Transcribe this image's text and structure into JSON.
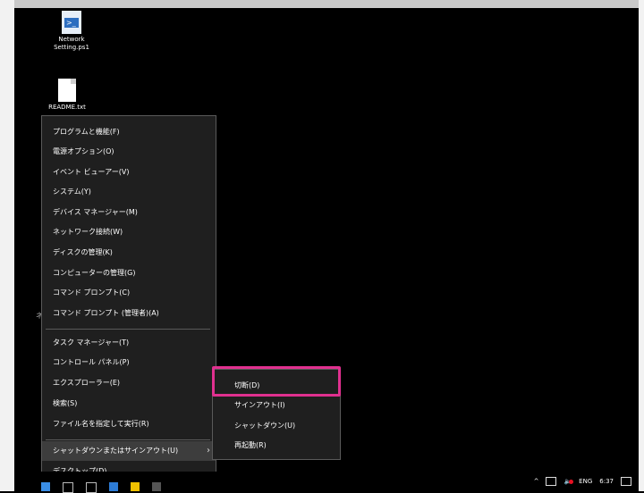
{
  "desktop_icons": [
    {
      "label_line1": "Network",
      "label_line2": "Setting.ps1",
      "icon": "powershell-script-icon"
    },
    {
      "label_line1": "README.txt",
      "label_line2": "",
      "icon": "text-file-icon"
    }
  ],
  "context_menu": {
    "items": [
      "プログラムと機能(F)",
      "電源オプション(O)",
      "イベント ビューアー(V)",
      "システム(Y)",
      "デバイス マネージャー(M)",
      "ネットワーク接続(W)",
      "ディスクの管理(K)",
      "コンピューターの管理(G)",
      "コマンド プロンプト(C)",
      "コマンド プロンプト (管理者)(A)",
      "タスク マネージャー(T)",
      "コントロール パネル(P)",
      "エクスプローラー(E)",
      "検索(S)",
      "ファイル名を指定して実行(R)",
      "シャットダウンまたはサインアウト(U)",
      "デスクトップ(D)"
    ],
    "submenu_chevron": "›"
  },
  "submenu": {
    "items": [
      "切断(D)",
      "サインアウト(I)",
      "シャットダウン(U)",
      "再起動(R)"
    ],
    "highlight_color": "#e0308f"
  },
  "taskbar": {
    "language": "ENG",
    "time": "6:37",
    "tray_chevron": "^"
  }
}
